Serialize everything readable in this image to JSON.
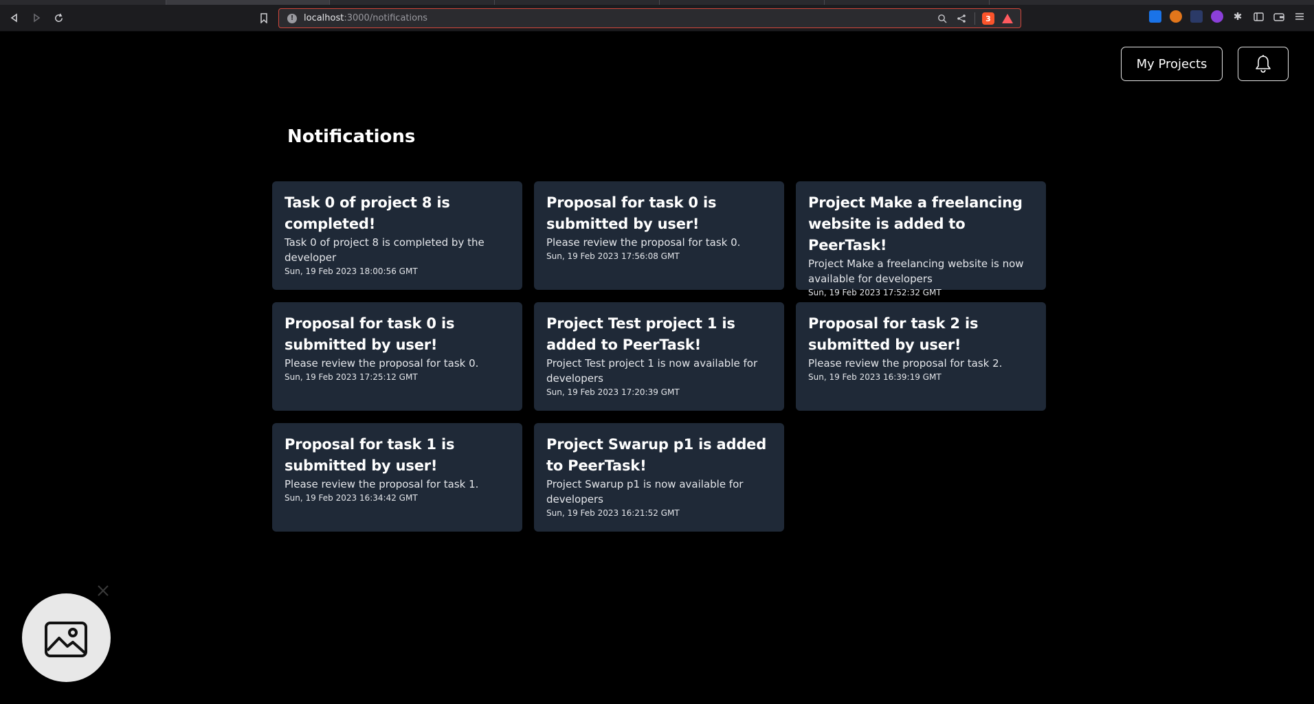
{
  "browser": {
    "url_host": "localhost",
    "url_rest": ":3000/notifications",
    "brave_badge": "3"
  },
  "nav": {
    "my_projects_label": "My Projects"
  },
  "page": {
    "title": "Notifications"
  },
  "notifications": [
    {
      "title": "Task 0 of project 8 is completed!",
      "body": "Task 0 of project 8 is completed by the developer",
      "date": "Sun, 19 Feb 2023 18:00:56 GMT"
    },
    {
      "title": "Proposal for task 0 is submitted by user!",
      "body": "Please review the proposal for task 0.",
      "date": "Sun, 19 Feb 2023 17:56:08 GMT"
    },
    {
      "title": "Project Make a freelancing website is added to PeerTask!",
      "body": "Project Make a freelancing website is now available for developers",
      "date": "Sun, 19 Feb 2023 17:52:32 GMT"
    },
    {
      "title": "Proposal for task 0 is submitted by user!",
      "body": "Please review the proposal for task 0.",
      "date": "Sun, 19 Feb 2023 17:25:12 GMT"
    },
    {
      "title": "Project Test project 1 is added to PeerTask!",
      "body": "Project Test project 1 is now available for developers",
      "date": "Sun, 19 Feb 2023 17:20:39 GMT"
    },
    {
      "title": "Proposal for task 2 is submitted by user!",
      "body": "Please review the proposal for task 2.",
      "date": "Sun, 19 Feb 2023 16:39:19 GMT"
    },
    {
      "title": "Proposal for task 1 is submitted by user!",
      "body": "Please review the proposal for task 1.",
      "date": "Sun, 19 Feb 2023 16:34:42 GMT"
    },
    {
      "title": "Project Swarup p1 is added to PeerTask!",
      "body": "Project Swarup p1 is now available for developers",
      "date": "Sun, 19 Feb 2023 16:21:52 GMT"
    }
  ],
  "colors": {
    "background": "#000000",
    "card": "#1f2937",
    "url_border": "#d1463a"
  }
}
